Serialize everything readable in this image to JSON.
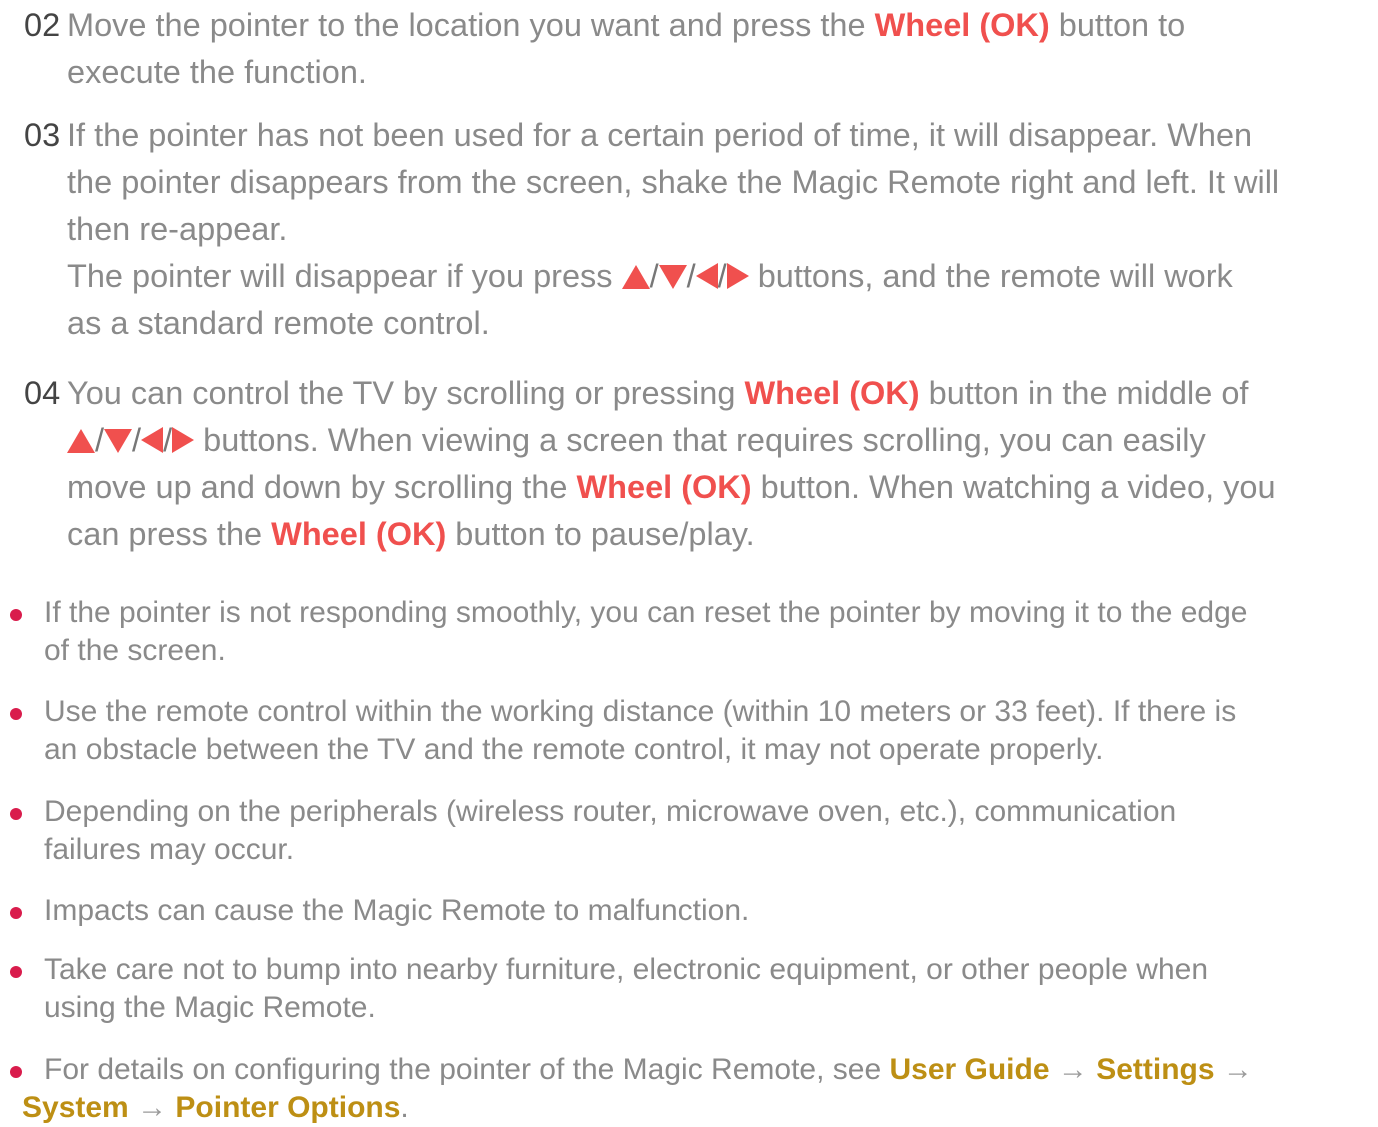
{
  "steps": [
    {
      "number": "02",
      "lines": [
        {
          "a": "Move the pointer to the location you want and press the ",
          "hl": "Wheel (OK)",
          "b": " button to"
        },
        {
          "a": "execute the function."
        }
      ]
    },
    {
      "number": "03",
      "lines": [
        {
          "a": "If the pointer has not been used for a certain period of time, it will disappear. When"
        },
        {
          "a": "the pointer disappears from the screen, shake the Magic Remote right and left. It will"
        },
        {
          "a": "then re-appear."
        },
        {
          "a": "The pointer will disappear if you press ",
          "b": " buttons, and the remote will work"
        },
        {
          "a": "as a standard remote control."
        }
      ]
    },
    {
      "number": "04",
      "lines": [
        {
          "a": "You can control the TV by scrolling or pressing ",
          "hl": "Wheel (OK)",
          "b": " button in the middle of"
        },
        {
          "b": " buttons. When viewing a screen that requires scrolling, you can easily"
        },
        {
          "a": "move up and down by scrolling the ",
          "hl": "Wheel (OK)",
          "b": " button. When watching a video, you"
        },
        {
          "a": "can press the ",
          "hl": "Wheel (OK)",
          "b": " button to pause/play."
        }
      ]
    }
  ],
  "arrow_separator": "/",
  "notes": [
    [
      "If the pointer is not responding smoothly, you can reset the pointer by moving it to the edge",
      "of the screen."
    ],
    [
      "Use the remote control within the working distance (within 10 meters or 33 feet). If there is",
      "an obstacle between the TV and the remote control, it may not operate properly."
    ],
    [
      "Depending on the peripherals (wireless router, microwave oven, etc.), communication",
      "failures may occur."
    ],
    [
      "Impacts can cause the Magic Remote to malfunction."
    ],
    [
      "Take care not to bump into nearby furniture, electronic equipment, or other people when",
      "using the Magic Remote."
    ]
  ],
  "last_note": {
    "intro": "For details on configuring the pointer of the Magic Remote, see ",
    "path": [
      "User Guide",
      "Settings",
      "System",
      "Pointer Options"
    ],
    "arrow": "→",
    "end": "."
  },
  "colors": {
    "text": "#8a8a8a",
    "number": "#444444",
    "highlight_red": "#f0504e",
    "link_gold": "#bd8f14",
    "bullet": "#d91c4c"
  }
}
